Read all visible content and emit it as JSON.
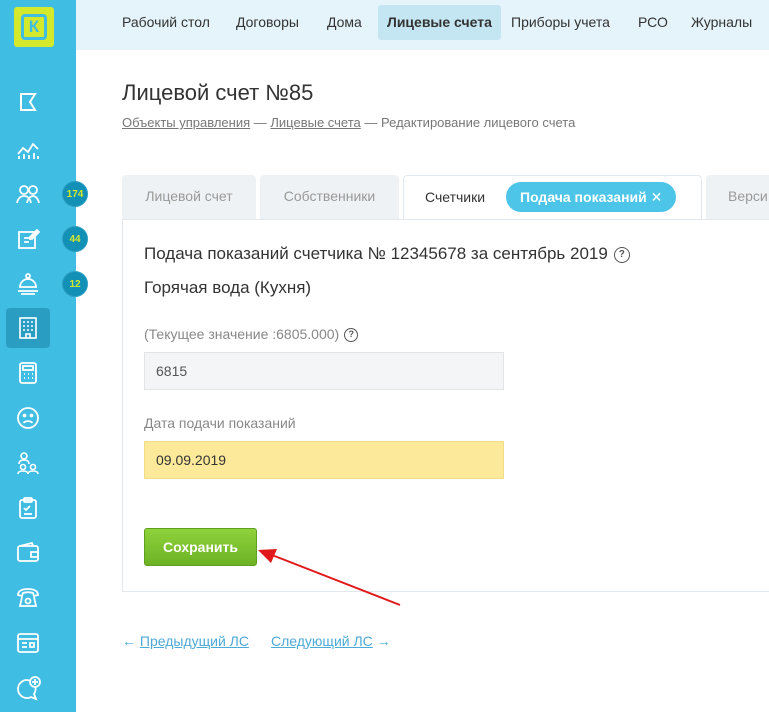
{
  "logo": {
    "letter": "К"
  },
  "nav": [
    "Рабочий стол",
    "Договоры",
    "Дома",
    "Лицевые счета",
    "Приборы учета",
    "РСО",
    "Журналы"
  ],
  "sidebar": {
    "badges": [
      "174",
      "44",
      "12"
    ]
  },
  "page": {
    "title": "Лицевой счет №85",
    "breadcrumb": [
      "Объекты управления",
      "Лицевые счета",
      "Редактирование лицевого счета"
    ],
    "separator": "—"
  },
  "tabs": [
    "Лицевой счет",
    "Собственники",
    "Счетчики",
    "Подача показаний ✕",
    "Верси"
  ],
  "form": {
    "title": "Подача показаний счетчика № 12345678 за сентябрь 2019",
    "subtitle": "Горячая вода (Кухня)",
    "current_label": "(Текущее значение :6805.000)",
    "current_value": "6815",
    "date_label": "Дата подачи показаний",
    "date_value": "09.09.2019",
    "help_glyph": "?",
    "save_label": "Сохранить"
  },
  "pager": {
    "prev": "Предыдущий ЛС",
    "next": "Следующий ЛС",
    "prev_arrow": "←",
    "next_arrow": "→"
  },
  "colors": {
    "sidebar": "#40bde3",
    "accent": "#d4e92b",
    "save": "#7cc12e",
    "date_field": "#fde99a",
    "arrow": "#e0191b"
  }
}
